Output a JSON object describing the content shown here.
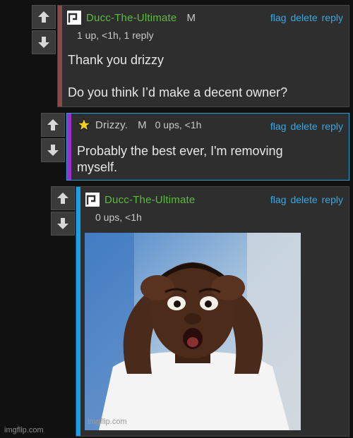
{
  "comments": [
    {
      "username": "Ducc-The-Ultimate",
      "mod_badge": "M",
      "meta": "1 up, <1h, 1 reply",
      "actions": [
        "flag",
        "delete",
        "reply"
      ],
      "body_line1": "Thank you drizzy",
      "body_line2": "Do you think I’d make a decent owner?",
      "bar_color": "#8b4a4a",
      "avatar": "imgflip-user-icon"
    },
    {
      "username": "Drizzy.",
      "mod_badge": "M",
      "meta": "0 ups, <1h",
      "actions": [
        "flag",
        "delete",
        "reply"
      ],
      "body_line1": "Probably the best ever, I'm removing",
      "body_line2": "myself.",
      "bar_color": "#9b2fc9",
      "border_color": "#2a9fd8",
      "avatar": "star-icon"
    },
    {
      "username": "Ducc-The-Ultimate",
      "meta": "0 ups, <1h",
      "actions": [
        "flag",
        "delete",
        "reply"
      ],
      "bar_color": "#18a0e6",
      "avatar": "imgflip-user-icon",
      "image": "shocked-man-holding-head-photo",
      "image_watermark": "imgflip.com"
    }
  ],
  "footer_watermark": "imgflip.com",
  "colors": {
    "background": "#111111",
    "panel": "#2e2e2e",
    "username_green": "#5dbb3f",
    "link_blue": "#35a9e8"
  }
}
